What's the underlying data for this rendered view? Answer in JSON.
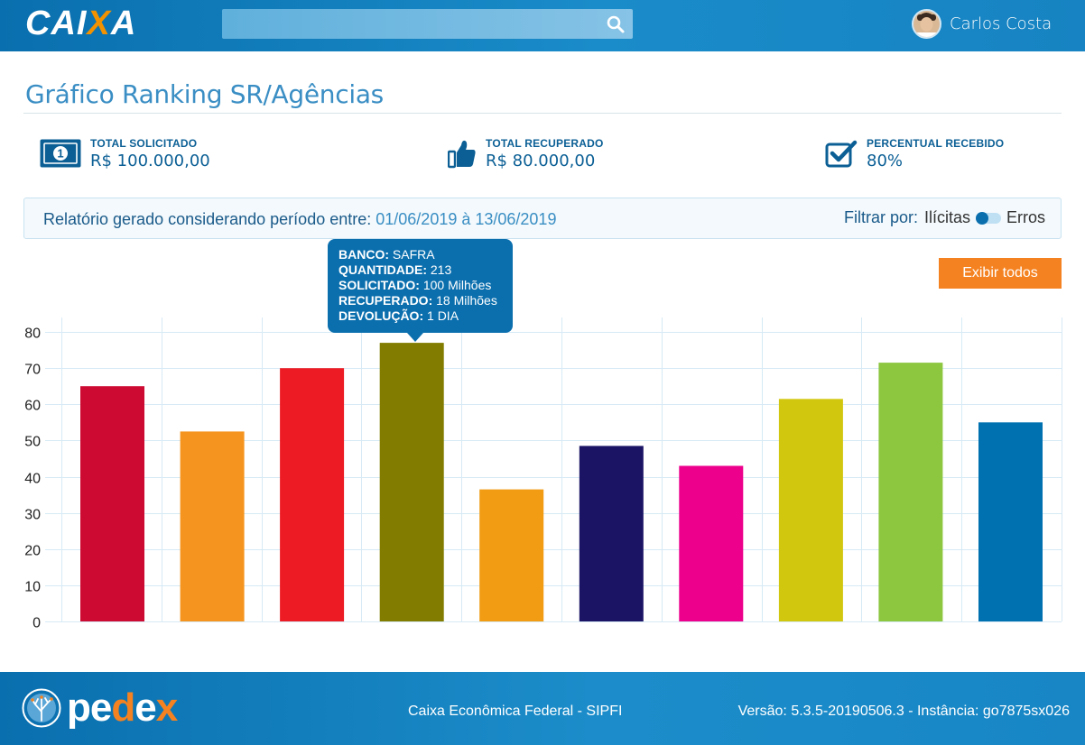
{
  "header": {
    "logo_main": "CAIXA",
    "user_name": "Carlos Costa"
  },
  "page": {
    "title": "Gráfico Ranking SR/Agências"
  },
  "kpis": [
    {
      "label": "TOTAL SOLICITADO",
      "value": "R$ 100.000,00",
      "icon": "money-bill-icon"
    },
    {
      "label": "TOTAL RECUPERADO",
      "value": "R$ 80.000,00",
      "icon": "thumbs-up-icon"
    },
    {
      "label": "PERCENTUAL RECEBIDO",
      "value": "80%",
      "icon": "checkbox-icon"
    }
  ],
  "report": {
    "prefix": "Relatório gerado considerando período entre:",
    "dates": "01/06/2019 à 13/06/2019",
    "filter_label": "Filtrar por:",
    "option_left": "Ilícitas",
    "option_right": "Erros",
    "toggle_selected": "Ilícitas"
  },
  "actions": {
    "show_all": "Exibir todos"
  },
  "tooltip": {
    "rows": [
      {
        "key": "BANCO:",
        "value": "SAFRA"
      },
      {
        "key": "QUANTIDADE:",
        "value": "213"
      },
      {
        "key": "SOLICITADO:",
        "value": "100 Milhões"
      },
      {
        "key": "RECUPERADO:",
        "value": "18 Milhões"
      },
      {
        "key": "DEVOLUÇÃO:",
        "value": "1 DIA"
      }
    ]
  },
  "chart_data": {
    "type": "bar",
    "values": [
      65,
      52.5,
      70,
      77,
      36.5,
      48.5,
      43,
      61.5,
      71.5,
      55
    ],
    "colors": [
      "#cc0a32",
      "#f5951f",
      "#ed1c24",
      "#827d00",
      "#f29c13",
      "#1b1464",
      "#ec008c",
      "#d2c70f",
      "#8dc63f",
      "#0071b0"
    ],
    "ylim": [
      0,
      80
    ],
    "yticks": [
      "0",
      "10",
      "20",
      "30",
      "40",
      "50",
      "60",
      "70",
      "80"
    ],
    "grid": true,
    "highlighted_index": 3
  },
  "footer": {
    "brand": "pedex",
    "center": "Caixa Econômica Federal - SIPFI",
    "version": "Versão: 5.3.5-20190506.3 - Instância: go7875sx026"
  },
  "colors": {
    "primary": "#0b6fae",
    "accent": "#f58220"
  }
}
